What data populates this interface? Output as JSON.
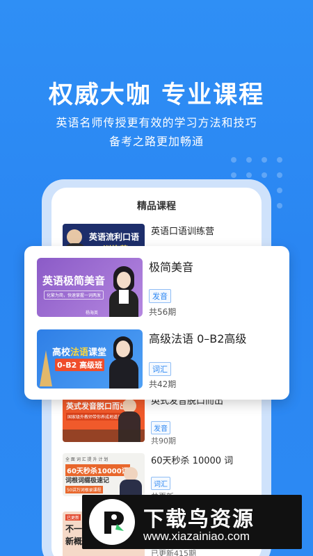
{
  "hero": {
    "title": "权威大咖  专业课程",
    "subtitle_line1": "英语名师传授更有效的学习方法和技巧",
    "subtitle_line2": "备考之路更加畅通"
  },
  "screen": {
    "title": "精品课程",
    "courses": [
      {
        "title": "英语口语训练营",
        "thumb_text": "英语流利口语",
        "thumb_text2": "训练营"
      },
      {
        "title": "英式发音脱口而出",
        "tag": "发音",
        "count": "共90期",
        "thumb_text": "英式发音脱口而出",
        "thumb_sub": "国家级外教师带你养成地道美发音"
      },
      {
        "title": "60天秒杀 10000 词",
        "tag": "词汇",
        "count": "共更新",
        "thumb_text": "60天秒杀10000词",
        "thumb_text2": "词根词缀极速记",
        "thumb_top": "全 面 词 汇 提 升 计 划",
        "thumb_sub": "50讲万词根录课程"
      },
      {
        "title": "",
        "count": "已更新415期",
        "thumb_text": "不一",
        "thumb_text2": "新概",
        "thumb_top": "已更新"
      }
    ]
  },
  "featured": [
    {
      "title": "极简美音",
      "tag": "发音",
      "count": "共56期",
      "thumb_text": "英语极简美音",
      "thumb_sub": "化繁为简，快速掌握一词两发",
      "thumb_name": "杨海英"
    },
    {
      "title": "高级法语 0–B2高级",
      "tag": "词汇",
      "count": "共42期",
      "thumb_text1": "高校",
      "thumb_text_hl": "法语",
      "thumb_text3": "课堂",
      "thumb_text2": "0-B2 高级班"
    }
  ],
  "watermark": {
    "name": "下载鸟资源",
    "url": "www.xiazainiao.com"
  },
  "colors": {
    "background": "#2d8af3",
    "accent": "#2b86f2",
    "card": "#ffffff"
  }
}
